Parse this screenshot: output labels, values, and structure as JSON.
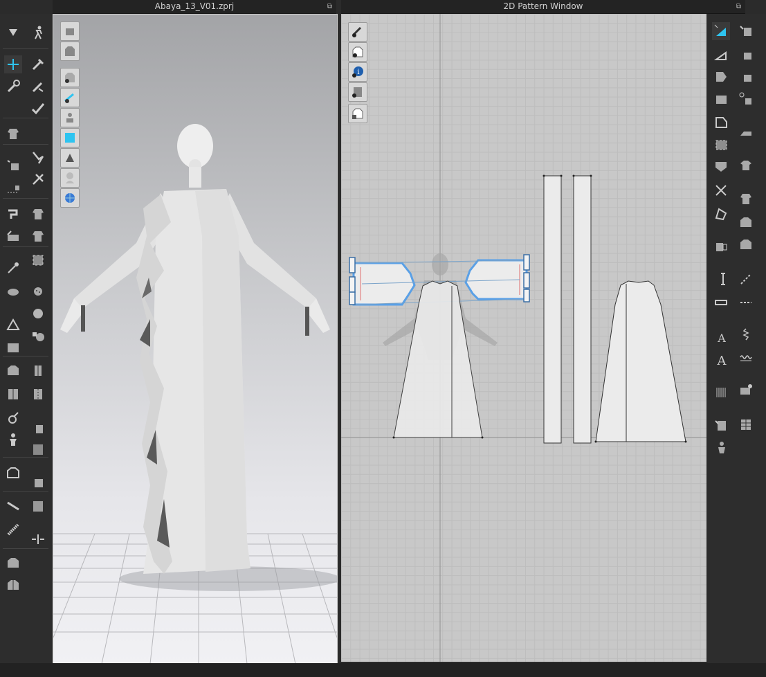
{
  "window_3d": {
    "title": "Abaya_13_V01.zprj",
    "popout_icon": "popout-icon"
  },
  "window_2d": {
    "title": "2D Pattern Window",
    "popout_icon": "popout-icon"
  },
  "left_toolbar_icons": [
    "simulation-down-icon",
    "avatar-pose-icon",
    "select-move-icon",
    "pin-icon",
    "transform-pattern-icon",
    "tack-icon",
    "fold-icon",
    "edit-curvature-icon",
    "arrange-icon",
    "fold-arrangement-icon",
    "select-points-icon",
    "steam-icon",
    "sew-icon",
    "garment-fit-icon",
    "measure-icon",
    "button-icon",
    "fabric-icon",
    "buttonhole-icon",
    "zipper-icon",
    "trim-icon",
    "layer-icon",
    "topstitch-icon",
    "puckering-icon",
    "tape-icon",
    "hanger-icon",
    "roll-icon",
    "pattern-graphic-icon",
    "solidify-icon",
    "iron-icon",
    "shirring-icon"
  ],
  "view3d_toolbar_icons": [
    "texture-view-icon",
    "garment-view-icon",
    "show-garment-icon",
    "show-pins-icon",
    "show-avatar-icon",
    "surface-view-icon",
    "thickness-icon",
    "avatar-silhouette-icon",
    "globe-render-icon"
  ],
  "view2d_toolbar_icons": [
    "show-tools-icon",
    "show-garment-2d-icon",
    "info-icon",
    "show-fabric-icon",
    "lock-pattern-icon"
  ],
  "right_toolbar_icons": [
    "transform-2d-icon",
    "segment-icon",
    "add-point-icon",
    "polygon-icon",
    "rectangle-icon",
    "internal-polygon-icon",
    "dart-icon",
    "trace-icon",
    "cut-icon",
    "offset-icon",
    "symmetry-icon",
    "grading-icon",
    "ruler-icon",
    "text-icon",
    "annotation-icon",
    "grid-icon",
    "seam-allowance-icon",
    "stitch-icon",
    "gather-icon",
    "fold-line-icon",
    "iron-2d-icon",
    "tshirt-icon"
  ]
}
